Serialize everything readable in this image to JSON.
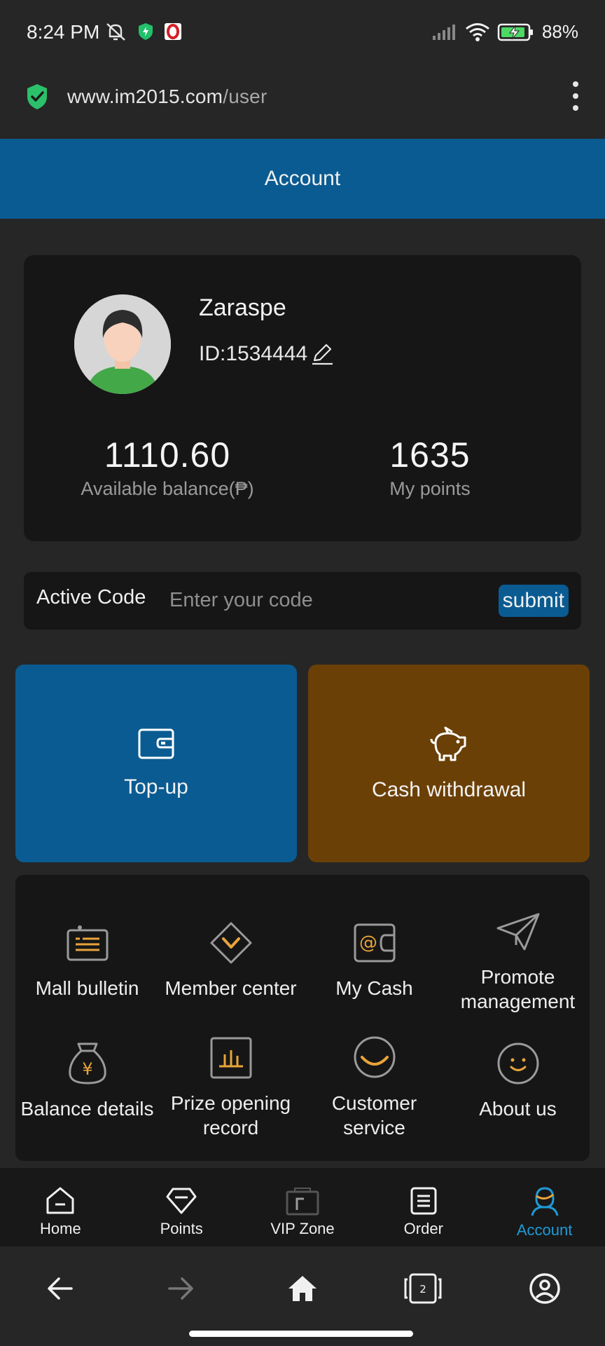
{
  "status_bar": {
    "time": "8:24 PM",
    "battery": "88%"
  },
  "browser": {
    "url_domain": "www.im2015.com",
    "url_path": "/user",
    "tab_count": "2"
  },
  "header": {
    "title": "Account"
  },
  "profile": {
    "name": "Zaraspe",
    "id": "ID:1534444",
    "balance_value": "1110.60",
    "balance_label": "Available balance(₱)",
    "points_value": "1635",
    "points_label": "My points"
  },
  "active_code": {
    "label": "Active Code",
    "placeholder": "Enter your code",
    "submit_label": "submit"
  },
  "actions": {
    "topup_label": "Top-up",
    "withdraw_label": "Cash withdrawal"
  },
  "menu": [
    {
      "label": "Mall bulletin",
      "icon": "bulletin-icon"
    },
    {
      "label": "Member center",
      "icon": "member-center-icon"
    },
    {
      "label": "My Cash",
      "icon": "wallet-icon"
    },
    {
      "label": "Promote management",
      "icon": "paper-plane-icon"
    },
    {
      "label": "Balance details",
      "icon": "money-bag-icon"
    },
    {
      "label": "Prize opening record",
      "icon": "bar-chart-icon"
    },
    {
      "label": "Customer service",
      "icon": "smile-bubble-icon"
    },
    {
      "label": "About us",
      "icon": "smiley-icon"
    }
  ],
  "tabs": [
    {
      "label": "Home",
      "icon": "home-icon"
    },
    {
      "label": "Points",
      "icon": "diamond-icon"
    },
    {
      "label": "VIP Zone",
      "icon": "vip-icon"
    },
    {
      "label": "Order",
      "icon": "order-icon"
    },
    {
      "label": "Account",
      "icon": "user-icon",
      "active": true
    }
  ],
  "colors": {
    "primary": "#0a5b92",
    "withdraw": "#6b4006",
    "accent_icon": "#e8a43a",
    "active_tab": "#1f9ad6"
  }
}
